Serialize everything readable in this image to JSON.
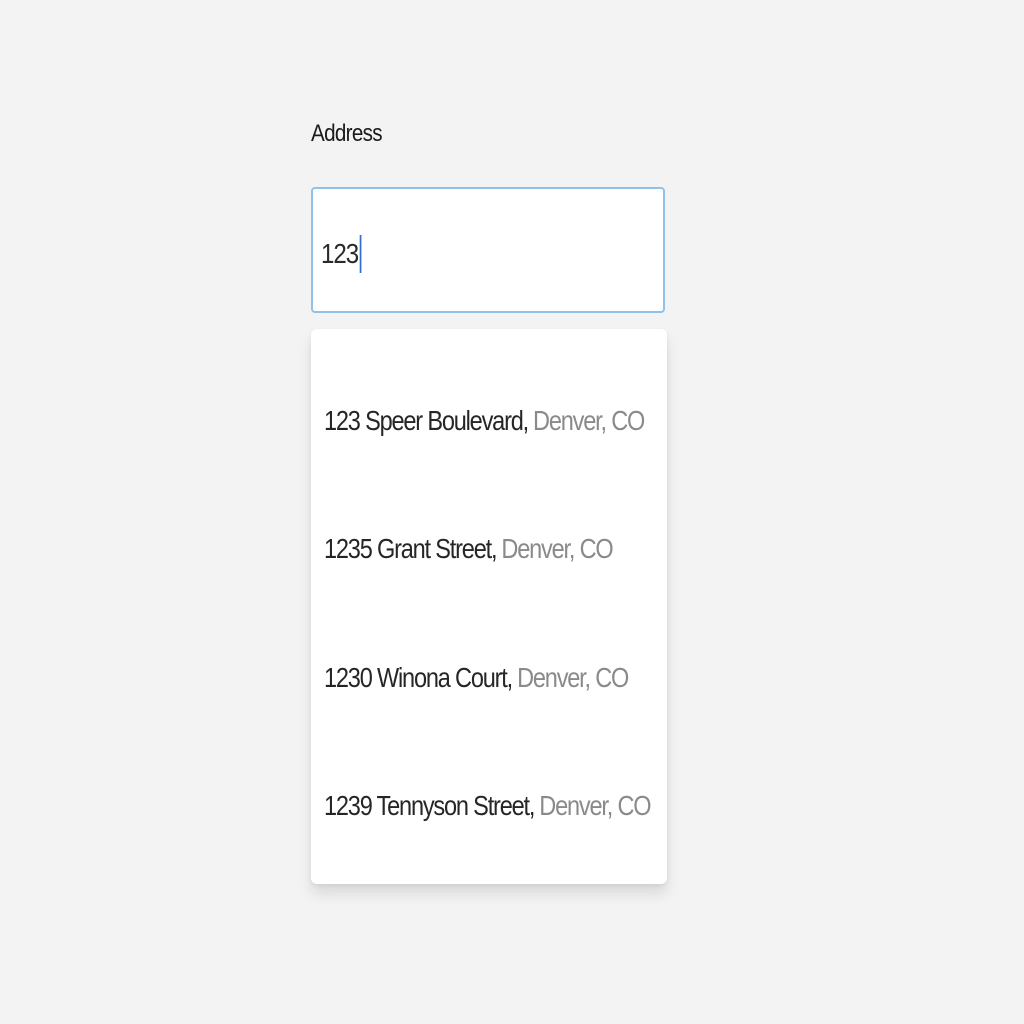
{
  "form": {
    "address_label": "Address",
    "address_value": "123"
  },
  "suggestions": [
    {
      "street": "123 Speer Boulevard,",
      "city": "Denver, CO"
    },
    {
      "street": "1235 Grant Street,",
      "city": "Denver, CO"
    },
    {
      "street": "1230 Winona Court,",
      "city": "Denver, CO"
    },
    {
      "street": "1239 Tennyson Street,",
      "city": "Denver, CO"
    }
  ],
  "colors": {
    "background": "#f3f3f3",
    "focus_border": "#8fc2ea",
    "caret": "#2f6fd0",
    "secondary_text": "#8a8a8a"
  }
}
